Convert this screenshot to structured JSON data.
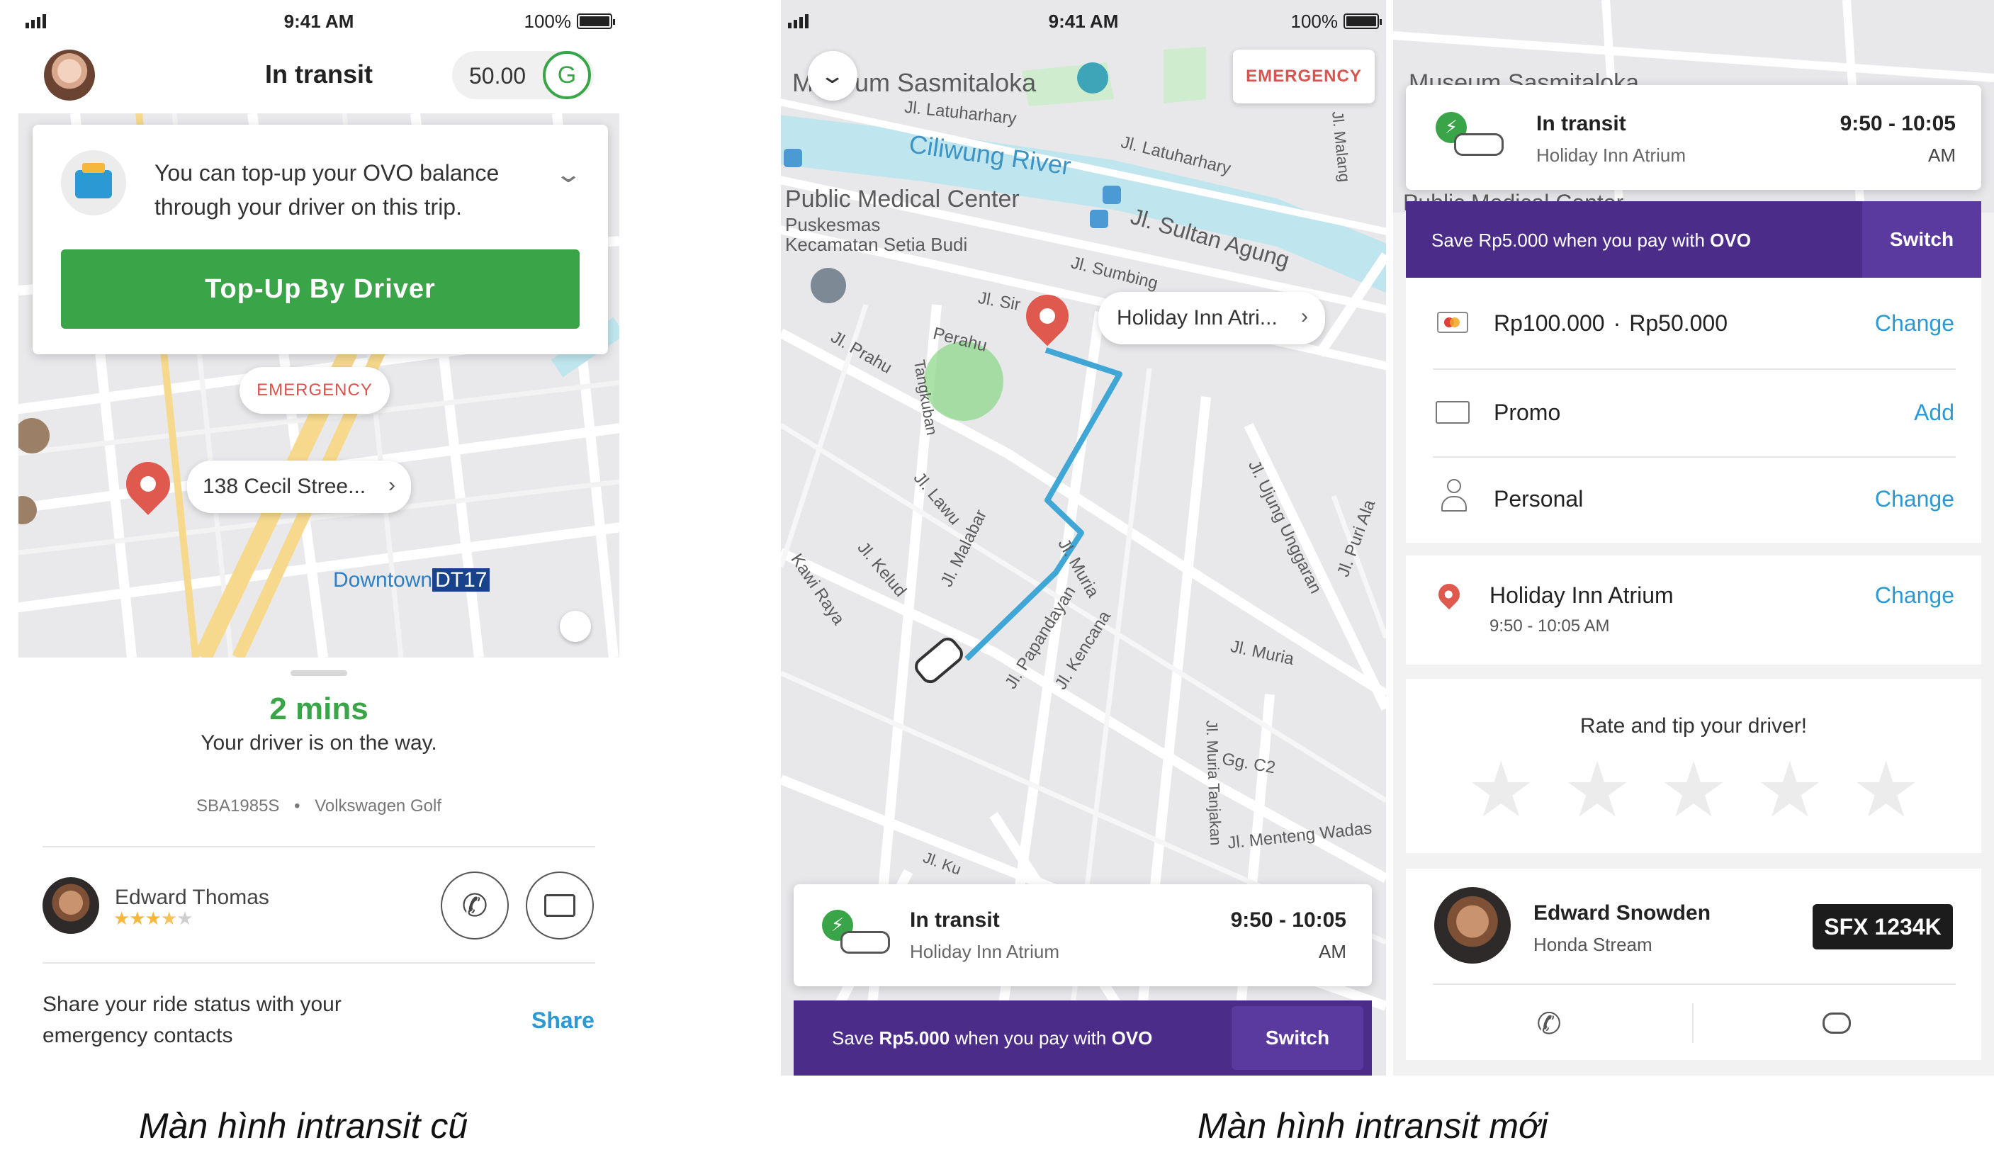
{
  "old_screen": {
    "status": {
      "time": "9:41 AM",
      "battery": "100%"
    },
    "header": {
      "title": "In transit",
      "points": "50.00",
      "points_icon": "G"
    },
    "topup_card": {
      "message_line1": "You can top-up your OVO balance",
      "message_line2": "through your driver on this trip.",
      "button_label": "Top-Up By Driver"
    },
    "map": {
      "emergency_label": "EMERGENCY",
      "destination": "138 Cecil Stree...",
      "station_label": "Downtown",
      "station_code": "DT17"
    },
    "eta": {
      "minutes": "2 mins",
      "subtitle": "Your driver is on the way."
    },
    "vehicle": {
      "plate": "SBA1985S",
      "separator": "•",
      "model": "Volkswagen Golf"
    },
    "driver": {
      "name": "Edward Thomas",
      "rating_stars": 3.5
    },
    "share": {
      "line1": "Share your ride status with your",
      "line2": "emergency contacts",
      "action": "Share"
    }
  },
  "new_map_screen": {
    "status": {
      "time": "9:41 AM",
      "battery": "100%"
    },
    "emergency_label": "EMERGENCY",
    "destination": "Holiday Inn Atri...",
    "map_labels": {
      "museum": "Museum Sasmitaloka",
      "river": "Ciliwung River",
      "street1": "Jl. Latuharhary",
      "street2": "Jl. Latuharhary",
      "medical_title": "Public Medical Center",
      "medical_line2": "Puskesmas",
      "medical_line3": "Kecamatan Setia Budi",
      "street_sultan": "Jl. Sultan Agung",
      "street_sumbing": "Jl. Sumbing",
      "street_sir": "Jl. Sir",
      "street_prahu": "Jl. Prahu",
      "street_perahu": "Perahu",
      "street_tangkuban": "Tangkuban",
      "street_lawu": "Jl. Lawu",
      "street_malabar": "Jl. Malabar",
      "street_kelud": "Jl. Kelud",
      "street_kawi": "Kawi Raya",
      "street_muria": "Jl. Muria",
      "street_papandayan": "Jl. Papandayan",
      "street_kencana": "Jl. Kencana",
      "street_muria2": "Jl. Muria",
      "street_ujung": "Jl. Ujung Unggaran",
      "street_puri": "Jl. Puri Ala",
      "street_malang": "Jl. Malang",
      "street_muria_tanjakan": "Jl. Muria Tanjakan",
      "street_gg": "Gg. C2",
      "street_menteng": "Jl. Menteng Wadas",
      "street_kuni": "Jl. Ku"
    },
    "transit_card": {
      "title": "In transit",
      "destination": "Holiday Inn Atrium",
      "time_range": "9:50 - 10:05",
      "time_suffix": "AM"
    },
    "ovo_banner": {
      "prefix": "Save ",
      "amount": "Rp5.000",
      "middle": " when you pay with ",
      "brand": "OVO",
      "action": "Switch"
    }
  },
  "new_detail_screen": {
    "map_labels": {
      "museum": "Museum Sasmitaloka",
      "medical": "Public Medical Center"
    },
    "transit_card": {
      "title": "In transit",
      "destination": "Holiday Inn Atrium",
      "time_range": "9:50 - 10:05",
      "time_suffix": "AM"
    },
    "ovo_banner": {
      "prefix": "Save Rp5.000 when you pay with ",
      "brand": "OVO",
      "action": "Switch"
    },
    "payment": {
      "amount_1": "Rp100.000",
      "separator": "·",
      "amount_2": "Rp50.000",
      "action": "Change"
    },
    "promo": {
      "label": "Promo",
      "action": "Add"
    },
    "profile": {
      "label": "Personal",
      "action": "Change"
    },
    "destination": {
      "name": "Holiday Inn Atrium",
      "time": "9:50 - 10:05 AM",
      "action": "Change"
    },
    "rating": {
      "title": "Rate and tip your driver!",
      "stars": 5
    },
    "driver": {
      "name": "Edward Snowden",
      "car": "Honda Stream",
      "plate": "SFX 1234K"
    }
  },
  "captions": {
    "old": "Màn hình intransit cũ",
    "new": "Màn hình intransit mới"
  },
  "colors": {
    "green": "#3aa548",
    "purple": "#4b2d89",
    "switch_purple": "#5b3aa0",
    "link_blue": "#2b9ad4",
    "emergency_red": "#d9534f",
    "route_blue": "#3fa6d6"
  }
}
